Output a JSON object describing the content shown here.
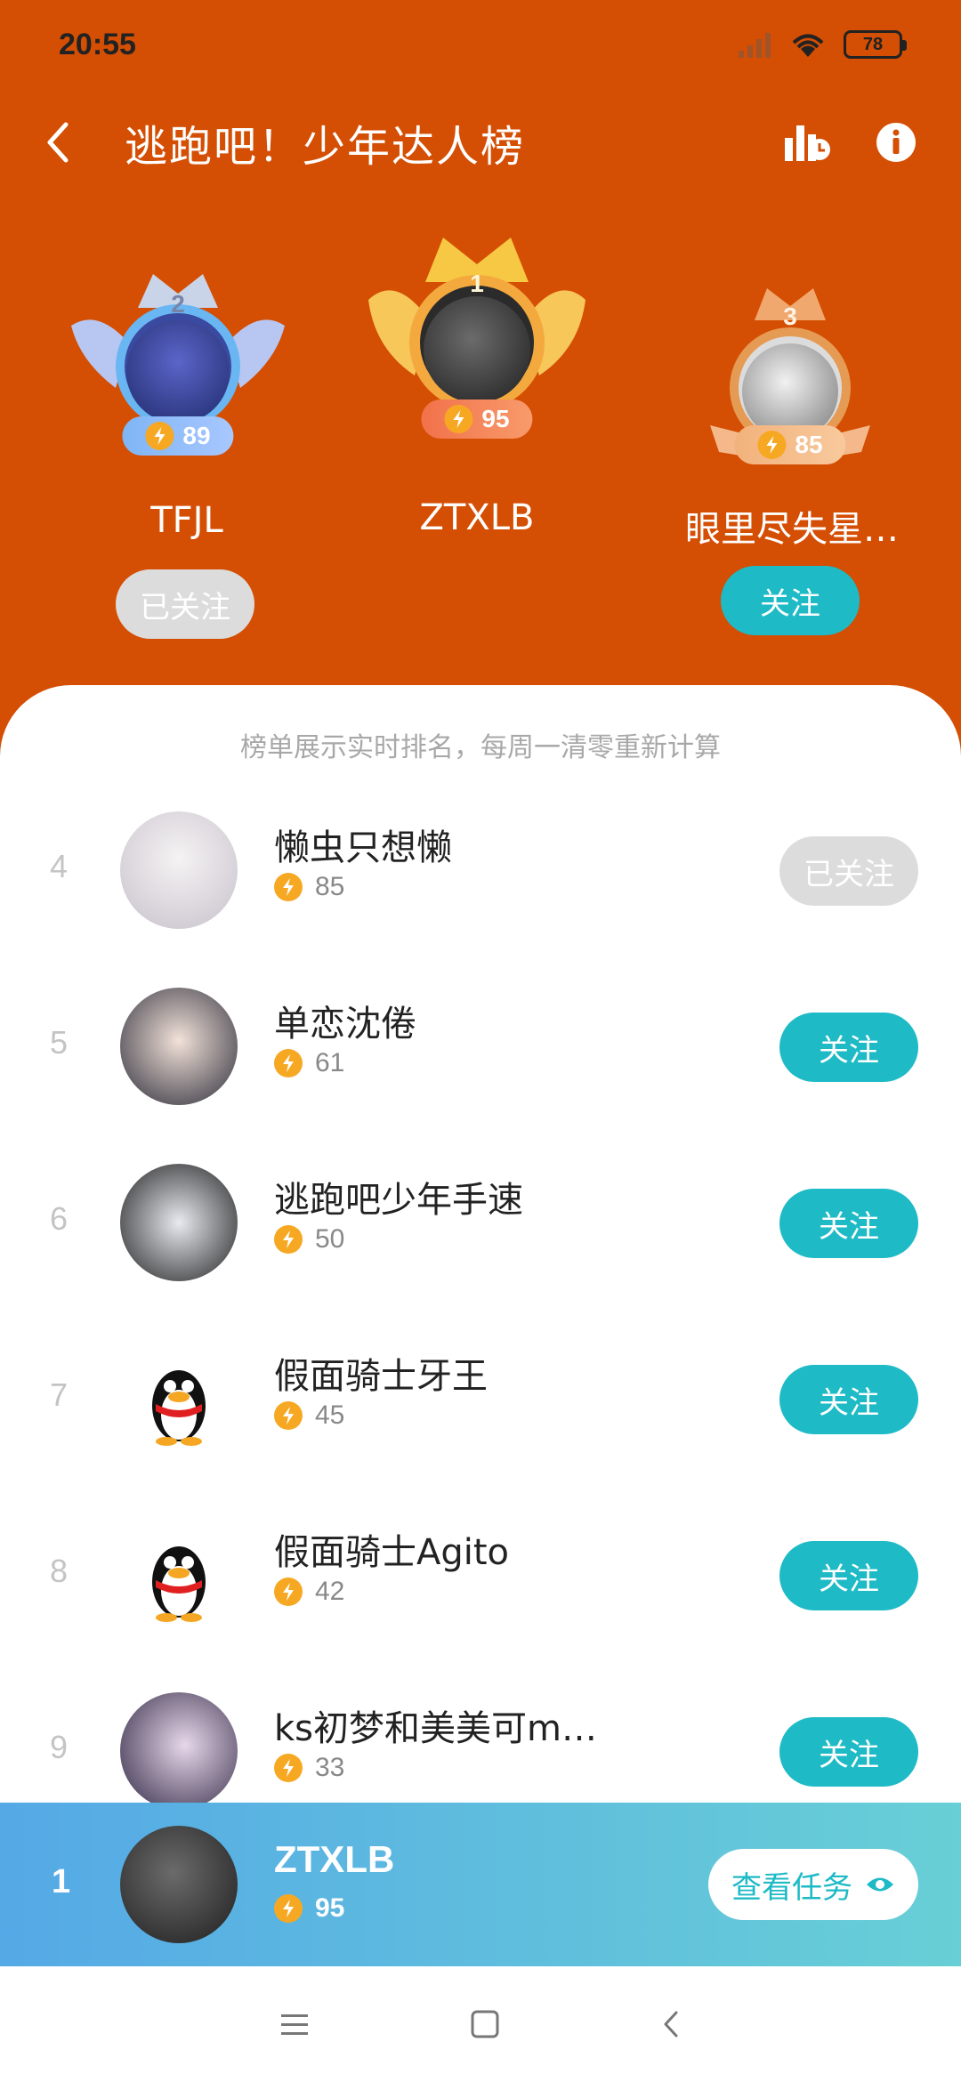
{
  "status": {
    "time": "20:55",
    "battery": "78"
  },
  "header": {
    "title": "逃跑吧！少年达人榜"
  },
  "podium": [
    {
      "rank": "2",
      "name": "TFJL",
      "score": "89",
      "button": "已关注",
      "followed": true
    },
    {
      "rank": "1",
      "name": "ZTXLB",
      "score": "95",
      "button": "",
      "followed": false
    },
    {
      "rank": "3",
      "name": "眼里尽失星…",
      "score": "85",
      "button": "关注",
      "followed": false
    }
  ],
  "note": "榜单展示实时排名，每周一清零重新计算",
  "list": [
    {
      "rank": "4",
      "name": "懒虫只想懒",
      "score": "85",
      "button": "已关注",
      "followed": true
    },
    {
      "rank": "5",
      "name": "单恋沈倦",
      "score": "61",
      "button": "关注",
      "followed": false
    },
    {
      "rank": "6",
      "name": "逃跑吧少年手速",
      "score": "50",
      "button": "关注",
      "followed": false
    },
    {
      "rank": "7",
      "name": "假面骑士牙王",
      "score": "45",
      "button": "关注",
      "followed": false
    },
    {
      "rank": "8",
      "name": "假面骑士Agito",
      "score": "42",
      "button": "关注",
      "followed": false
    },
    {
      "rank": "9",
      "name": "ks初梦和美美可m…",
      "score": "33",
      "button": "关注",
      "followed": false
    }
  ],
  "self": {
    "rank": "1",
    "name": "ZTXLB",
    "score": "95",
    "button": "查看任务"
  }
}
